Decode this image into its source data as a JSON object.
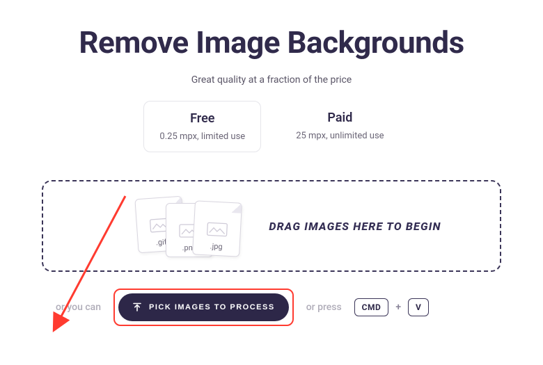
{
  "hero": {
    "title": "Remove Image Backgrounds",
    "subtitle": "Great quality at a fraction of the price"
  },
  "tiers": {
    "free": {
      "title": "Free",
      "detail": "0.25 mpx, limited use"
    },
    "paid": {
      "title": "Paid",
      "detail": "25 mpx, unlimited use"
    }
  },
  "dropzone": {
    "prompt": "DRAG IMAGES HERE TO BEGIN",
    "file_exts": {
      "a": ".gif",
      "b": ".png",
      "c": ".jpg"
    }
  },
  "actions": {
    "prefix": "or you can",
    "pick_button": "PICK IMAGES TO PROCESS",
    "suffix": "or press",
    "key1": "CMD",
    "key_plus": "+",
    "key2": "V"
  }
}
